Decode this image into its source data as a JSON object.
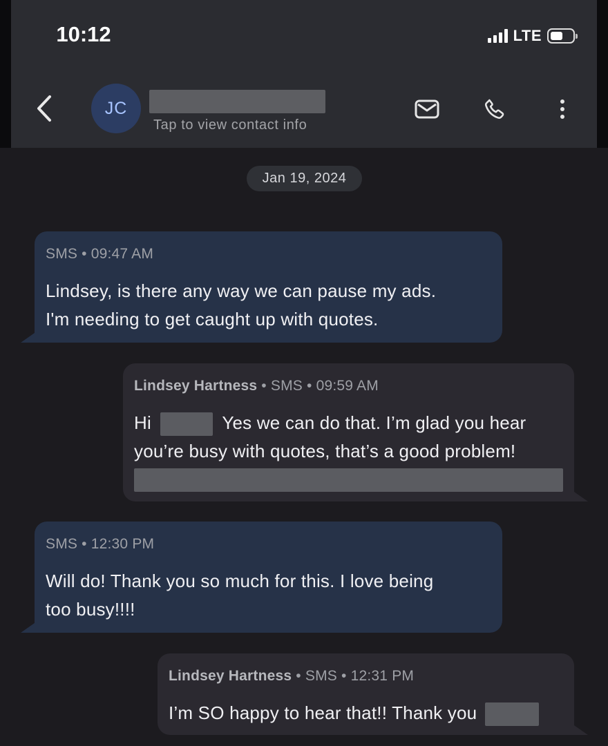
{
  "status_bar": {
    "time": "10:12",
    "network": "LTE",
    "battery_icon": "battery-icon",
    "signal_icon": "signal-bars-icon"
  },
  "header": {
    "avatar_initials": "JC",
    "contact_name": "",
    "subtitle": "Tap to view contact info",
    "icons": [
      "back-arrow-icon",
      "mail-icon",
      "phone-icon",
      "more-vertical-icon"
    ]
  },
  "date_separator": "Jan 19, 2024",
  "messages": [
    {
      "direction": "incoming",
      "meta": "SMS • 09:47 AM",
      "lines": [
        "Lindsey, is there any way we can pause my ads.",
        "I'm needing to get caught up with quotes."
      ]
    },
    {
      "direction": "outgoing",
      "sender": "Lindsey Hartness",
      "meta": " • SMS • 09:59 AM",
      "line1_prefix": "Hi",
      "line1_suffix": "Yes we can do that. I’m glad you hear",
      "line2": "you’re busy with quotes, that’s a good problem!"
    },
    {
      "direction": "incoming",
      "meta": "SMS • 12:30 PM",
      "lines": [
        "Will do!  Thank you so much for this.  I love being",
        "too busy!!!!"
      ]
    },
    {
      "direction": "outgoing",
      "sender": "Lindsey Hartness",
      "meta": " • SMS • 12:31 PM",
      "line1_prefix": "I’m SO happy to hear that!! Thank you"
    }
  ],
  "colors": {
    "background": "#1c1b1f",
    "header": "#2b2c31",
    "incoming_bubble": "#263248",
    "outgoing_bubble": "#2b2930",
    "avatar": "#2c3d63"
  }
}
